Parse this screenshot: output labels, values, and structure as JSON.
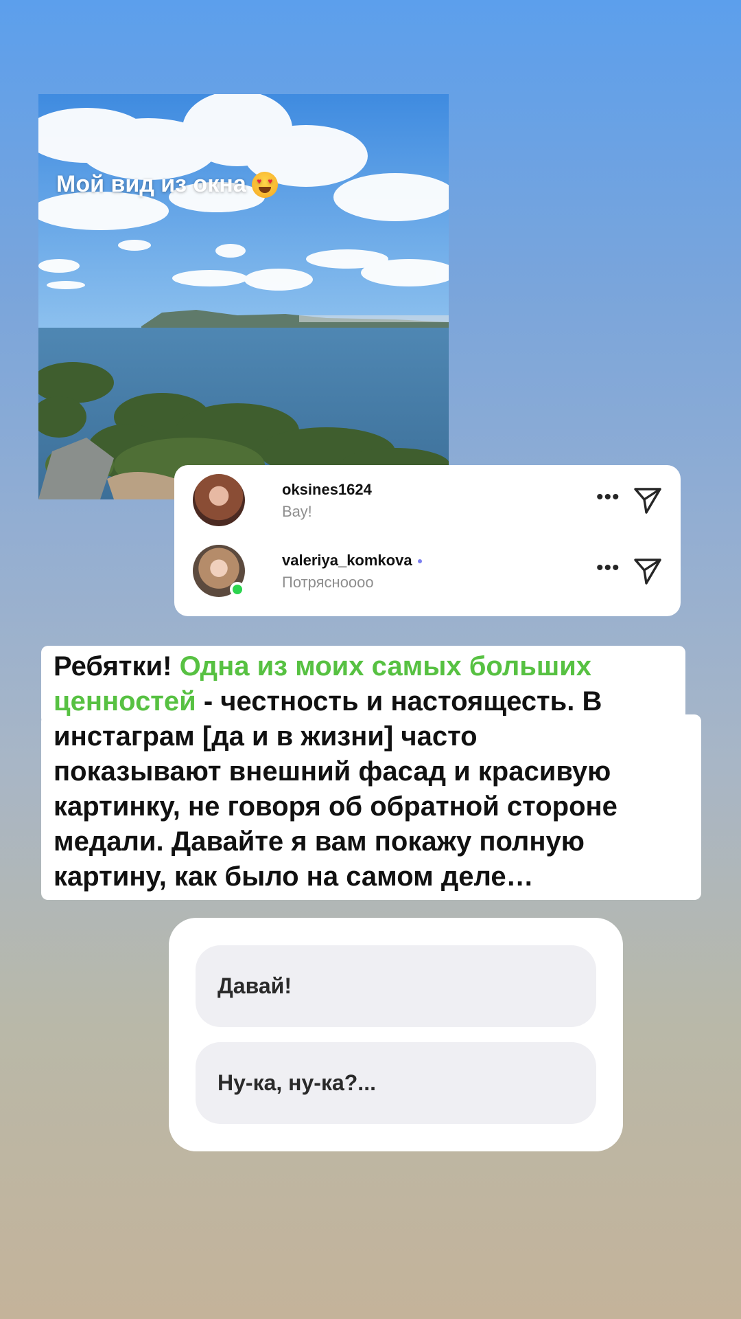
{
  "story": {
    "photo": {
      "caption": "Мой вид из окна",
      "emoji": "heart-eyes-emoji"
    },
    "comments": [
      {
        "username": "oksines1624",
        "text": "Вау!",
        "online": false,
        "verified": false
      },
      {
        "username": "valeriya_komkova",
        "text": "Потрясноооо",
        "online": true,
        "verified": true
      }
    ],
    "message": {
      "line1_plain": "Ребятки! ",
      "line1_green": "Одна из моих самых больших",
      "line2_green": "ценностей",
      "line2_plain": " - честность и настоящесть. В",
      "line3": "инстаграм [да и в жизни] часто",
      "line4": "показывают внешний фасад и красивую",
      "line5": "картинку, не говоря об обратной стороне",
      "line6": "медали. Давайте я вам покажу полную",
      "line7": "картину, как было на самом деле…"
    },
    "poll": {
      "options": [
        "Давай!",
        "Ну-ка, ну-ка?..."
      ]
    }
  },
  "colors": {
    "accent_green": "#57c142",
    "online_green": "#2bd44e",
    "background_top": "#5c9fec",
    "background_bottom": "#c4b39a"
  }
}
